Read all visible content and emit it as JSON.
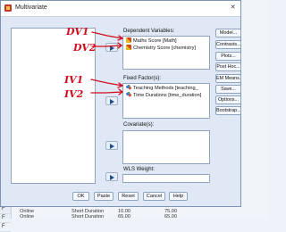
{
  "window": {
    "title": "Multivariate",
    "close_glyph": "✕"
  },
  "sections": {
    "dependent_label": "Dependent Variables:",
    "fixed_label": "Fixed Factor(s):",
    "covariate_label": "Covariate(s):",
    "wls_label": "WLS Weight:"
  },
  "dependent_items": [
    {
      "label": "Maths Score [Math]",
      "icon": "scale-icon"
    },
    {
      "label": "Chemistry Score [chemistry]",
      "icon": "scale-icon"
    }
  ],
  "fixed_items": [
    {
      "label": "Teaching Methods [teaching_",
      "icon": "nominal-icon"
    },
    {
      "label": "Time Durations [time_duration]",
      "icon": "nominal-icon"
    }
  ],
  "side_buttons": {
    "model": "Model...",
    "contrasts": "Contrasts...",
    "plots": "Plots...",
    "post_hoc": "Post Hoc...",
    "em_means": "EM Means...",
    "save": "Save...",
    "options": "Options...",
    "bootstrap": "Bootstrap..."
  },
  "bottom_buttons": {
    "ok": "OK",
    "paste": "Paste",
    "reset": "Reset",
    "cancel": "Cancel",
    "help": "Help"
  },
  "annotations": {
    "dv1": "DV1",
    "dv2": "DV2",
    "iv1": "IV1",
    "iv2": "IV2",
    "color": "#d10f1e"
  },
  "background": {
    "row_prefixes": [
      "F",
      "F",
      "F",
      "F",
      "F",
      "F",
      "F",
      "F",
      "F",
      "F",
      "F",
      "F",
      "F",
      "F",
      "F",
      "F",
      "F",
      "F",
      "F",
      "F",
      "F",
      "F",
      "F",
      "F"
    ],
    "rows": [
      {
        "group": "Online",
        "duration": "Short Duration",
        "v1": "",
        "v2": ""
      },
      {
        "group": "Online",
        "duration": "Short Duration",
        "v1": "10.00",
        "v2": "75.00"
      },
      {
        "group": "Online",
        "duration": "Short Duration",
        "v1": "65.00",
        "v2": "65.00"
      }
    ]
  }
}
